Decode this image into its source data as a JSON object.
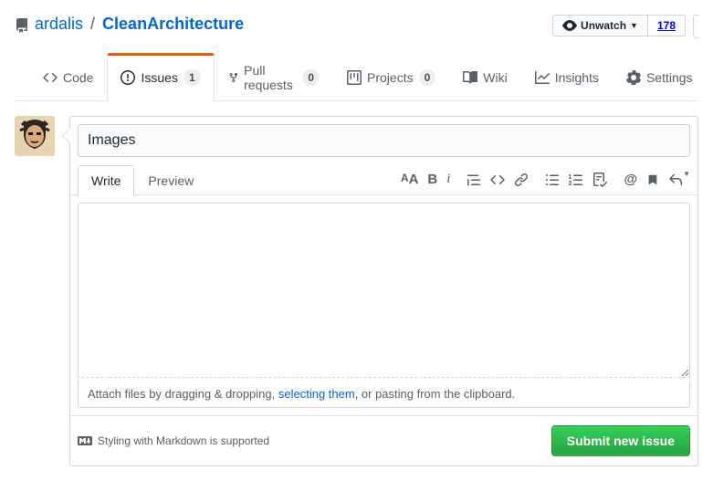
{
  "repo": {
    "owner": "ardalis",
    "name": "CleanArchitecture",
    "sep": "/"
  },
  "watch": {
    "label": "Unwatch",
    "count": "178"
  },
  "tabs": {
    "code": "Code",
    "issues": "Issues",
    "issues_count": "1",
    "pulls": "Pull requests",
    "pulls_count": "0",
    "projects": "Projects",
    "projects_count": "0",
    "wiki": "Wiki",
    "insights": "Insights",
    "settings": "Settings"
  },
  "issue": {
    "title": "Images",
    "body": ""
  },
  "mdtabs": {
    "write": "Write",
    "preview": "Preview"
  },
  "attach": {
    "pre": "Attach files by dragging & dropping, ",
    "link": "selecting them",
    "post": ", or pasting from the clipboard."
  },
  "mdhelp": "Styling with Markdown is supported",
  "submit": "Submit new issue"
}
